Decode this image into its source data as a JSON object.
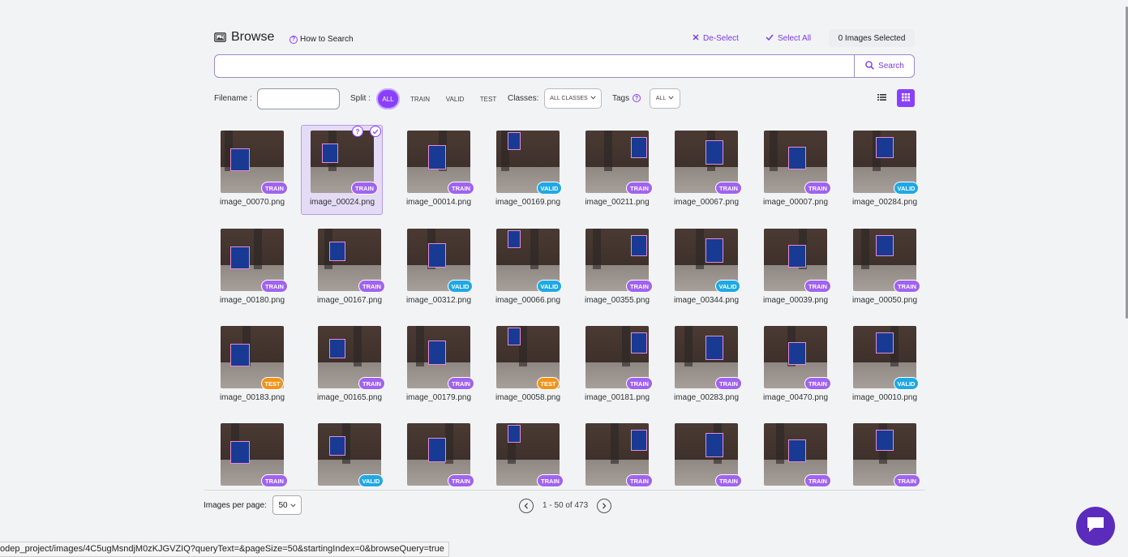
{
  "header": {
    "title": "Browse",
    "how_to": "How to Search",
    "deselect": "De-Select",
    "select_all": "Select All",
    "selected_count": "0 Images Selected"
  },
  "search": {
    "value": "",
    "button": "Search"
  },
  "filters": {
    "filename_label": "Filename :",
    "filename_value": "",
    "split_label": "Split :",
    "split_options": [
      "ALL",
      "TRAIN",
      "VALID",
      "TEST"
    ],
    "split_selected": "ALL",
    "classes_label": "Classes:",
    "classes_value": "ALL CLASSES",
    "tags_label": "Tags",
    "tags_value": "ALL"
  },
  "images": [
    {
      "name": "image_00070.png",
      "split": "TRAIN"
    },
    {
      "name": "image_00024.png",
      "split": "TRAIN"
    },
    {
      "name": "image_00014.png",
      "split": "TRAIN"
    },
    {
      "name": "image_00169.png",
      "split": "VALID"
    },
    {
      "name": "image_00211.png",
      "split": "TRAIN"
    },
    {
      "name": "image_00067.png",
      "split": "TRAIN"
    },
    {
      "name": "image_00007.png",
      "split": "TRAIN"
    },
    {
      "name": "image_00284.png",
      "split": "VALID"
    },
    {
      "name": "image_00180.png",
      "split": "TRAIN"
    },
    {
      "name": "image_00167.png",
      "split": "TRAIN"
    },
    {
      "name": "image_00312.png",
      "split": "VALID"
    },
    {
      "name": "image_00066.png",
      "split": "VALID"
    },
    {
      "name": "image_00355.png",
      "split": "TRAIN"
    },
    {
      "name": "image_00344.png",
      "split": "VALID"
    },
    {
      "name": "image_00039.png",
      "split": "TRAIN"
    },
    {
      "name": "image_00050.png",
      "split": "TRAIN"
    },
    {
      "name": "image_00183.png",
      "split": "TEST"
    },
    {
      "name": "image_00165.png",
      "split": "TRAIN"
    },
    {
      "name": "image_00179.png",
      "split": "TRAIN"
    },
    {
      "name": "image_00058.png",
      "split": "TEST"
    },
    {
      "name": "image_00181.png",
      "split": "TRAIN"
    },
    {
      "name": "image_00283.png",
      "split": "TRAIN"
    },
    {
      "name": "image_00470.png",
      "split": "TRAIN"
    },
    {
      "name": "image_00010.png",
      "split": "VALID"
    },
    {
      "name": "",
      "split": "TRAIN"
    },
    {
      "name": "",
      "split": "VALID"
    },
    {
      "name": "",
      "split": "TRAIN"
    },
    {
      "name": "",
      "split": "TRAIN"
    },
    {
      "name": "",
      "split": "TRAIN"
    },
    {
      "name": "",
      "split": "TRAIN"
    },
    {
      "name": "",
      "split": "TRAIN"
    },
    {
      "name": "",
      "split": "TRAIN"
    }
  ],
  "hovered_index": 1,
  "pagination": {
    "per_page_label": "Images per page:",
    "per_page": "50",
    "range": "1 - 50 of 473"
  },
  "status_url": "odep_project/images/4C5ugMsndjM0zKJGVZIQ?queryText=&pageSize=50&startingIndex=0&browseQuery=true",
  "colors": {
    "accent": "#8a3ffc",
    "train": "#a063f0",
    "valid": "#1fa8e5",
    "test": "#f0941b",
    "chat": "#5b2cbc"
  },
  "icons": {
    "browse": "image-gallery-icon",
    "how_to": "question-circle-icon",
    "deselect": "x-icon",
    "select_all": "check-icon",
    "search": "search-icon",
    "list_view": "list-icon",
    "grid_view": "grid-icon",
    "prev": "chevron-left-icon",
    "next": "chevron-right-icon",
    "chat": "chat-bubble-icon"
  }
}
